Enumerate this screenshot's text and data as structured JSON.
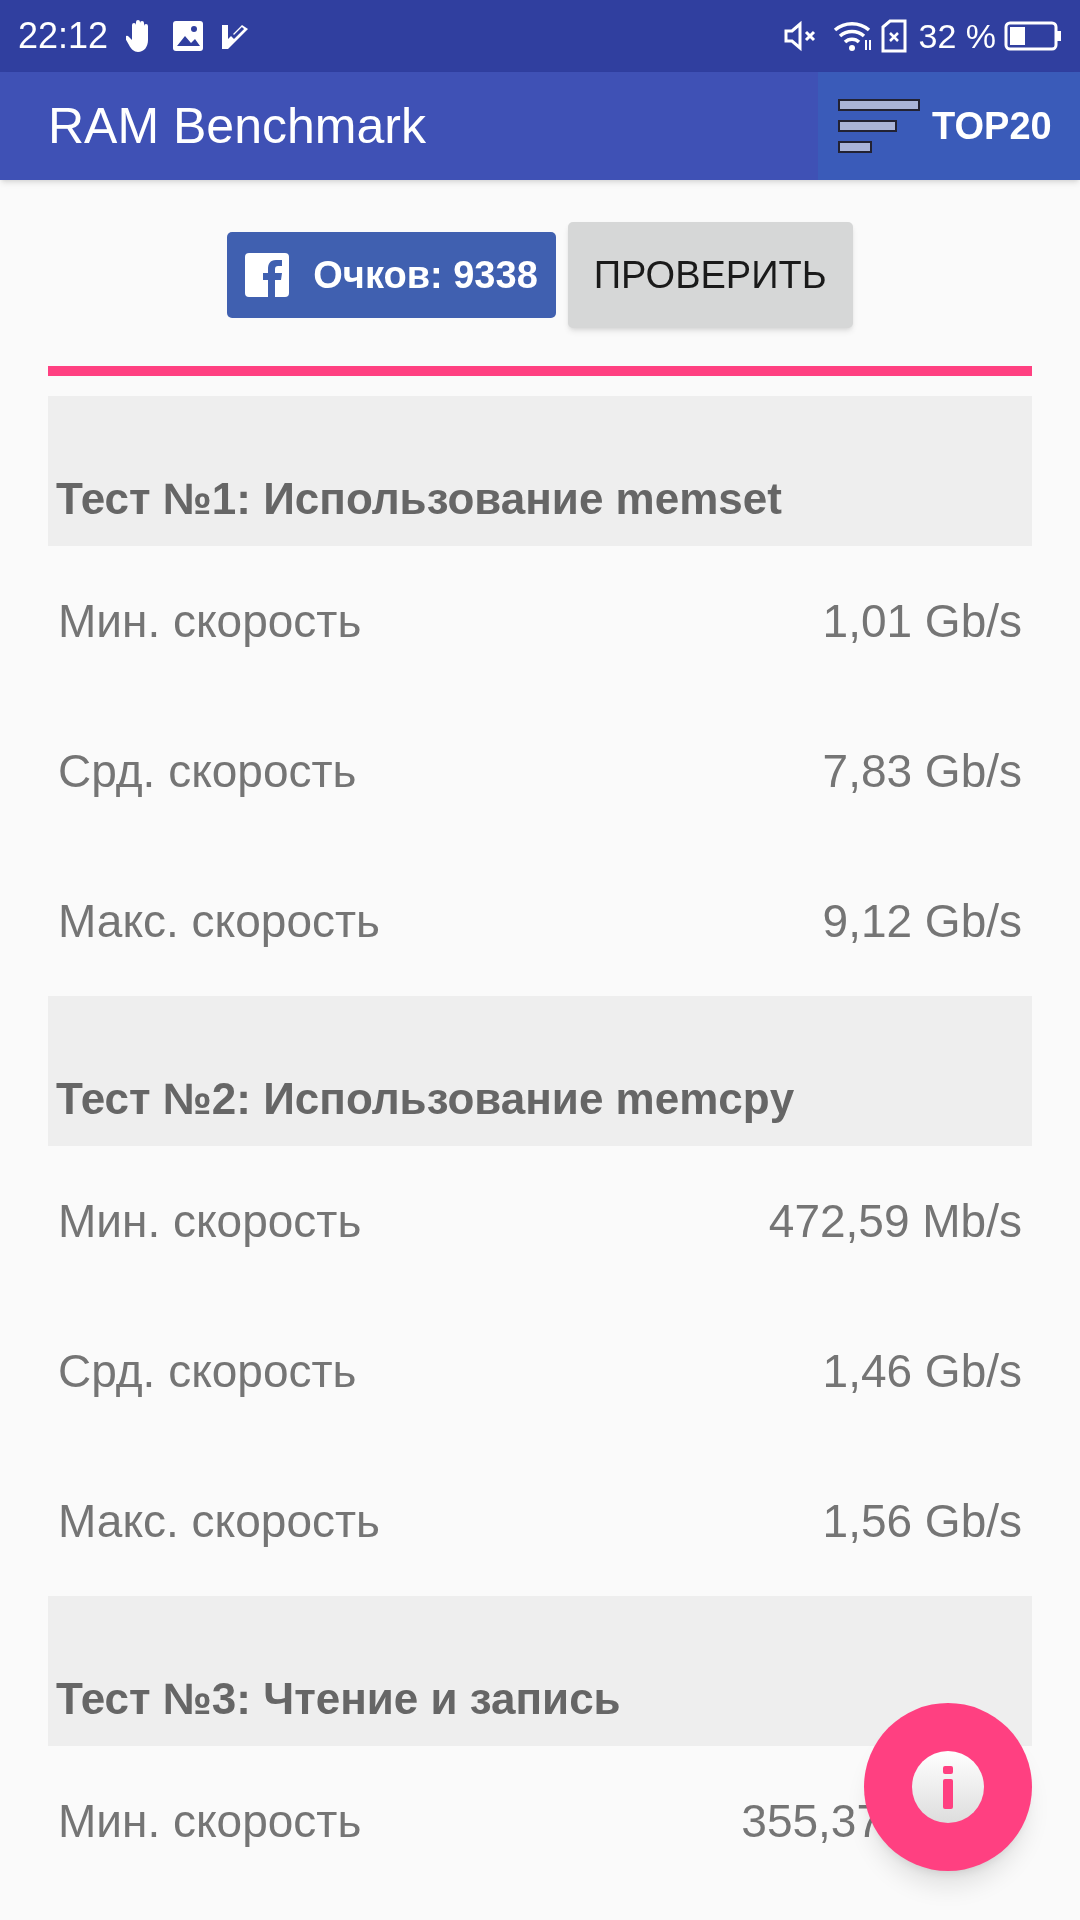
{
  "status_bar": {
    "time": "22:12",
    "battery_text": "32 %"
  },
  "app_bar": {
    "title": "RAM Benchmark",
    "top_button": "TOP20"
  },
  "score_button": "Очков: 9338",
  "check_button": "ПРОВЕРИТЬ",
  "sections": [
    {
      "title": "Тест №1: Использование memset",
      "rows": [
        {
          "label": "Мин. скорость",
          "value": "1,01 Gb/s"
        },
        {
          "label": "Срд. скорость",
          "value": "7,83 Gb/s"
        },
        {
          "label": "Макс. скорость",
          "value": "9,12 Gb/s"
        }
      ]
    },
    {
      "title": "Тест №2: Использование memcpy",
      "rows": [
        {
          "label": "Мин. скорость",
          "value": "472,59 Mb/s"
        },
        {
          "label": "Срд. скорость",
          "value": "1,46 Gb/s"
        },
        {
          "label": "Макс. скорость",
          "value": "1,56 Gb/s"
        }
      ]
    },
    {
      "title": "Тест №3: Чтение и запись",
      "rows": [
        {
          "label": "Мин. скорость",
          "value": "355,37"
        }
      ]
    }
  ]
}
